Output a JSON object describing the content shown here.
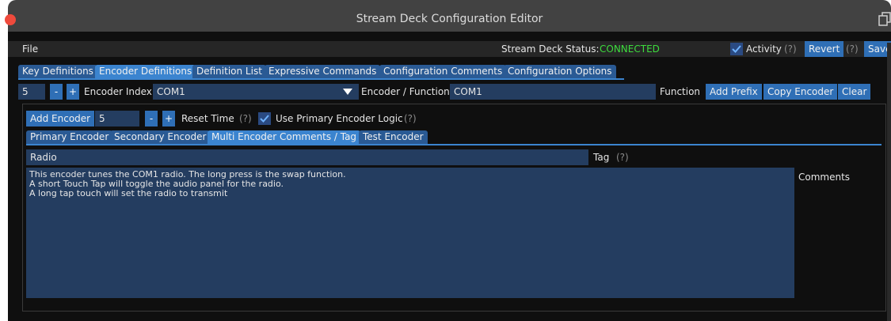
{
  "window": {
    "title": "Stream Deck Configuration Editor"
  },
  "menubar": {
    "file": "File",
    "status_label": "Stream Deck Status:",
    "status_value": "CONNECTED",
    "activity_label": "Activity",
    "help": "(?)",
    "revert": "Revert",
    "save": "Save"
  },
  "tabs": [
    "Key Definitions",
    "Encoder Definitions",
    "Definition List",
    "Expressive Commands",
    "Configuration Comments",
    "Configuration Options"
  ],
  "encoder_row": {
    "index_value": "5",
    "minus": "-",
    "plus": "+",
    "index_label": "Encoder Index",
    "index_select": "COM1",
    "function_label": "Encoder / Function",
    "function_value": "COM1",
    "function_text": "Function",
    "add_prefix": "Add Prefix",
    "copy_encoder": "Copy Encoder",
    "clear": "Clear"
  },
  "add_row": {
    "add_encoder": "Add Encoder",
    "value": "5",
    "minus": "-",
    "plus": "+",
    "reset_time": "Reset Time",
    "help": "(?)",
    "primary_logic": "Use Primary Encoder Logic",
    "help2": "(?)"
  },
  "subtabs": [
    "Primary Encoder",
    "Secondary Encoder",
    "Multi Encoder Comments / Tag",
    "Test Encoder"
  ],
  "tag": {
    "value": "Radio",
    "label": "Tag",
    "help": "(?)"
  },
  "comments": {
    "label": "Comments",
    "lines": [
      "This encoder tunes the COM1 radio. The long press is the swap function.",
      "A short Touch Tap will toggle the audio panel for the radio.",
      "A long tap touch will set the radio to transmit"
    ]
  },
  "colors": {
    "accent": "#3b84cf",
    "connected": "#3ddc3d",
    "field": "#243d60"
  }
}
